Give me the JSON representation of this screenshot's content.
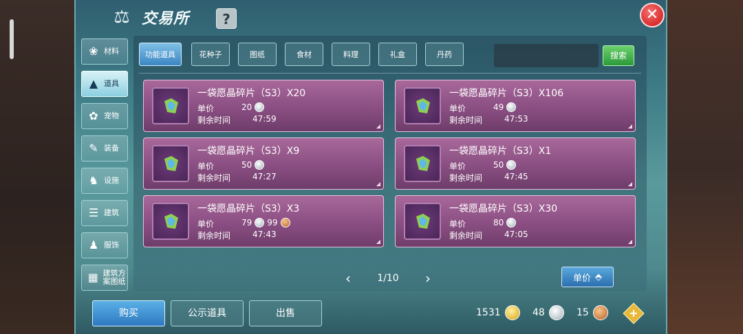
{
  "window": {
    "title": "交易所",
    "help_label": "?",
    "close_label": "✕"
  },
  "sidebar": {
    "items": [
      {
        "label": "材料",
        "icon": "materials-icon"
      },
      {
        "label": "道具",
        "icon": "item-icon",
        "active": true
      },
      {
        "label": "宠物",
        "icon": "paw-icon"
      },
      {
        "label": "装备",
        "icon": "equipment-icon"
      },
      {
        "label": "设施",
        "icon": "facility-icon"
      },
      {
        "label": "建筑",
        "icon": "building-icon"
      },
      {
        "label": "服饰",
        "icon": "clothing-icon"
      },
      {
        "label": "建筑方案图纸",
        "icon": "blueprint-icon"
      }
    ]
  },
  "tabs": [
    {
      "label": "功能道具",
      "active": true
    },
    {
      "label": "花种子"
    },
    {
      "label": "图纸"
    },
    {
      "label": "食材"
    },
    {
      "label": "料理"
    },
    {
      "label": "礼盒"
    },
    {
      "label": "丹药"
    }
  ],
  "search": {
    "value": "",
    "placeholder": "",
    "button_label": "搜索"
  },
  "labels": {
    "unit_price": "单价",
    "time_left": "剩余时间"
  },
  "listings": [
    {
      "name": "一袋愿晶碎片（S3）X20",
      "price": "20",
      "price2": "",
      "time": "47:59"
    },
    {
      "name": "一袋愿晶碎片（S3）X106",
      "price": "49",
      "price2": "",
      "time": "47:53"
    },
    {
      "name": "一袋愿晶碎片（S3）X9",
      "price": "50",
      "price2": "",
      "time": "47:27"
    },
    {
      "name": "一袋愿晶碎片（S3）X1",
      "price": "50",
      "price2": "",
      "time": "47:45"
    },
    {
      "name": "一袋愿晶碎片（S3）X3",
      "price": "79",
      "price2": "99",
      "time": "47:43"
    },
    {
      "name": "一袋愿晶碎片（S3）X30",
      "price": "80",
      "price2": "",
      "time": "47:05"
    }
  ],
  "pager": {
    "page": "1/10",
    "prev": "‹",
    "next": "›"
  },
  "sort": {
    "label": "单价"
  },
  "bottom": {
    "buy": "购买",
    "public": "公示道具",
    "sell": "出售"
  },
  "currency": {
    "gold": "1531",
    "silver": "48",
    "copper": "15",
    "add_label": "+"
  },
  "colors": {
    "listing_bg": "#8a4e82",
    "accent_blue": "#3b86c4",
    "search_green": "#2a9a3a"
  }
}
